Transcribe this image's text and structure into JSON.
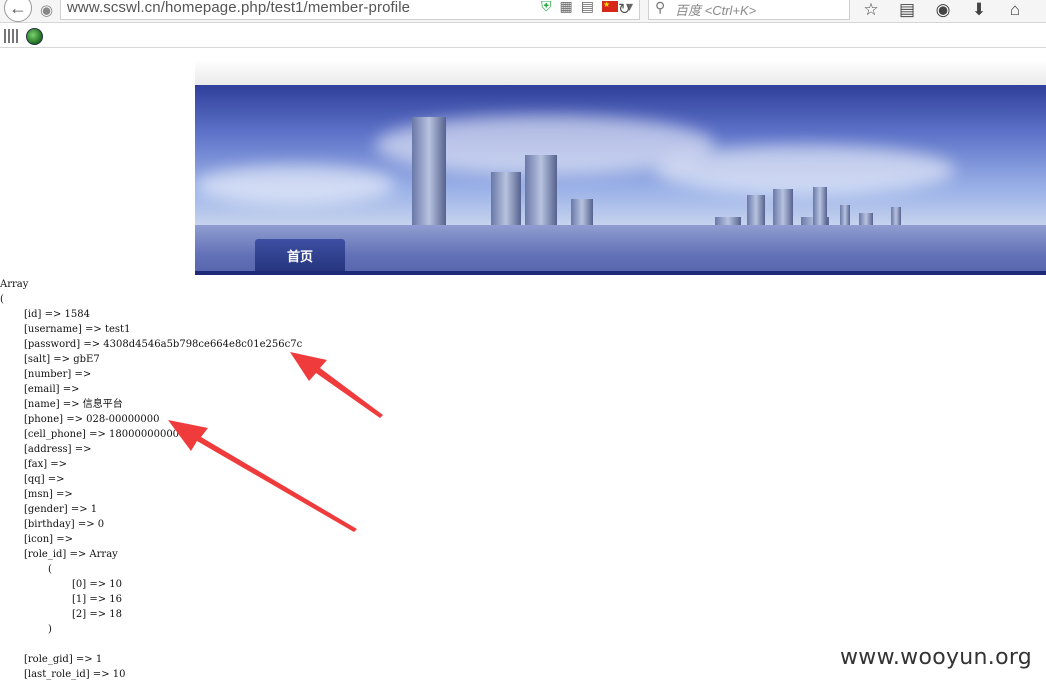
{
  "browser": {
    "url": "www.scswl.cn/homepage.php/test1/member-profile",
    "search_placeholder": "百度 <Ctrl+K>"
  },
  "banner": {
    "nav_home": "首页"
  },
  "dump": {
    "lines": [
      {
        "indent": 0,
        "text": "Array"
      },
      {
        "indent": 0,
        "text": "("
      },
      {
        "indent": 24,
        "text": "[id] => 1584"
      },
      {
        "indent": 24,
        "text": "[username] => test1"
      },
      {
        "indent": 24,
        "text": "[password] => 4308d4546a5b798ce664e8c01e256c7c"
      },
      {
        "indent": 24,
        "text": "[salt] => gbE7"
      },
      {
        "indent": 24,
        "text": "[number] =>"
      },
      {
        "indent": 24,
        "text": "[email] =>"
      },
      {
        "indent": 24,
        "text": "[name] => 信息平台"
      },
      {
        "indent": 24,
        "text": "[phone] => 028-00000000"
      },
      {
        "indent": 24,
        "text": "[cell_phone] => 18000000000"
      },
      {
        "indent": 24,
        "text": "[address] =>"
      },
      {
        "indent": 24,
        "text": "[fax] =>"
      },
      {
        "indent": 24,
        "text": "[qq] =>"
      },
      {
        "indent": 24,
        "text": "[msn] =>"
      },
      {
        "indent": 24,
        "text": "[gender] => 1"
      },
      {
        "indent": 24,
        "text": "[birthday] => 0"
      },
      {
        "indent": 24,
        "text": "[icon] =>"
      },
      {
        "indent": 24,
        "text": "[role_id] => Array"
      },
      {
        "indent": 48,
        "text": "("
      },
      {
        "indent": 72,
        "text": "[0] => 10"
      },
      {
        "indent": 72,
        "text": "[1] => 16"
      },
      {
        "indent": 72,
        "text": "[2] => 18"
      },
      {
        "indent": 48,
        "text": ")"
      },
      {
        "indent": 0,
        "text": ""
      },
      {
        "indent": 24,
        "text": "[role_gid] => 1"
      },
      {
        "indent": 24,
        "text": "[last_role_id] => 10"
      }
    ]
  },
  "watermark": "www.wooyun.org",
  "colors": {
    "arrow": "#ef3b3b",
    "banner_sky": "#5d72c8"
  }
}
